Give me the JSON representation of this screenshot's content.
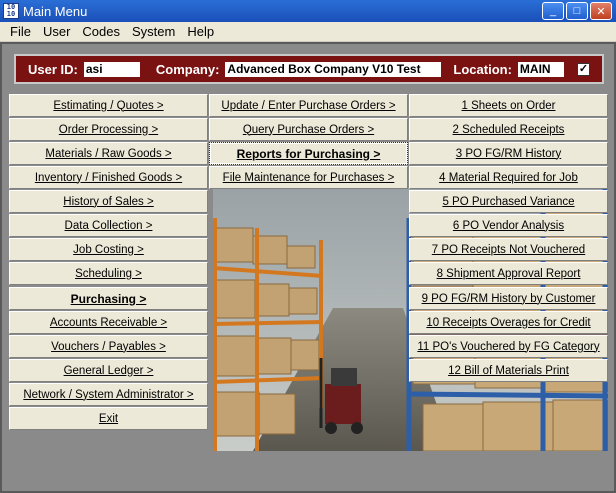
{
  "window": {
    "title": "Main Menu",
    "icon_text": "10 10",
    "min": "_",
    "max": "□",
    "close": "✕"
  },
  "menubar": [
    "File",
    "User",
    "Codes",
    "System",
    "Help"
  ],
  "infobar": {
    "user_label": "User ID:",
    "user_value": "asi",
    "company_label": "Company:",
    "company_value": "Advanced Box Company V10 Test",
    "location_label": "Location:",
    "location_value": "MAIN",
    "checkbox": "✓"
  },
  "main_menu": [
    "Estimating / Quotes >",
    "Order Processing >",
    "Materials / Raw Goods >",
    "Inventory / Finished Goods >",
    "History of Sales >",
    "Data Collection >",
    "Job Costing >",
    "Scheduling >",
    "Purchasing >",
    "Accounts Receivable >",
    "Vouchers / Payables >",
    "General Ledger >",
    "Network / System Administrator >",
    "Exit"
  ],
  "purchasing_menu": [
    "Update / Enter Purchase Orders >",
    "Query Purchase Orders >",
    "Reports for Purchasing >",
    "File Maintenance for Purchases >"
  ],
  "reports_menu": [
    "1 Sheets on Order",
    "2 Scheduled Receipts",
    "3 PO FG/RM History",
    "4 Material Required for Job",
    "5 PO Purchased Variance",
    "6 PO Vendor Analysis",
    "7 PO Receipts Not Vouchered",
    "8 Shipment Approval Report",
    "9 PO FG/RM History by Customer",
    "10 Receipts Overages for Credit",
    "11 PO's  Vouchered by FG Category",
    "12 Bill of Materials Print"
  ]
}
